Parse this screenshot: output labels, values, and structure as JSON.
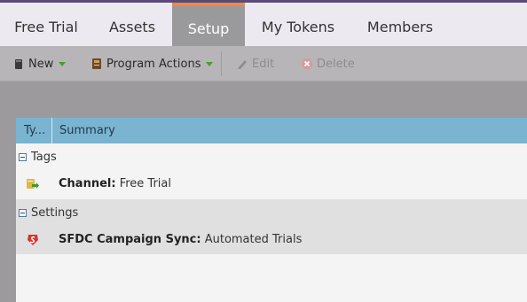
{
  "tabs": [
    {
      "label": "Free Trial"
    },
    {
      "label": "Assets"
    },
    {
      "label": "Setup",
      "active": true
    },
    {
      "label": "My Tokens"
    },
    {
      "label": "Members"
    }
  ],
  "toolbar": {
    "new_label": "New",
    "program_actions_label": "Program Actions",
    "edit_label": "Edit",
    "delete_label": "Delete"
  },
  "grid": {
    "col_type": "Ty...",
    "col_summary": "Summary"
  },
  "groups": {
    "tags": {
      "label": "Tags",
      "row": {
        "key": "Channel:",
        "value": " Free Trial",
        "icon": "channel-tag-icon"
      }
    },
    "settings": {
      "label": "Settings",
      "row": {
        "key": "SFDC Campaign Sync:",
        "value": " Automated Trials",
        "icon": "sfdc-sync-icon"
      }
    }
  },
  "colors": {
    "accent": "#f08a3c",
    "header_blue": "#7ab4d0",
    "brand_purple": "#5a4a7c"
  }
}
